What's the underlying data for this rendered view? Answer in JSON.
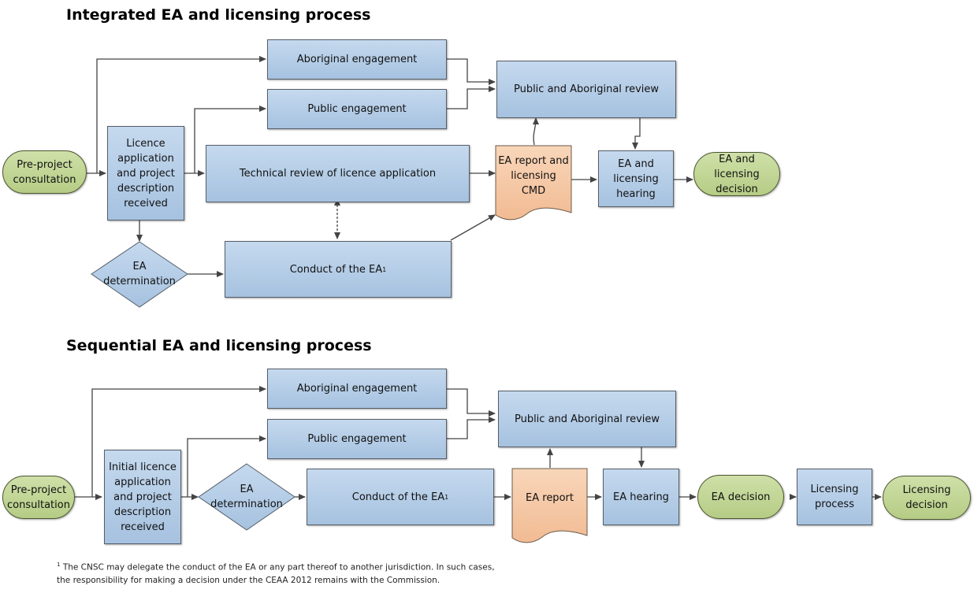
{
  "integrated": {
    "title": "Integrated EA and licensing process",
    "pre_project": "Pre-project\nconsultation",
    "licence_app": "Licence\napplication\nand project\ndescription\nreceived",
    "aboriginal": "Aboriginal engagement",
    "public": "Public engagement",
    "review": "Public and Aboriginal review",
    "technical": "Technical review of licence application",
    "ea_det": "EA\ndetermination",
    "conduct": "Conduct of the EA",
    "conduct_sup": "1",
    "report": "EA report and\nlicensing\nCMD",
    "hearing": "EA and\nlicensing\nhearing",
    "decision": "EA and\nlicensing\ndecision"
  },
  "sequential": {
    "title": "Sequential EA and licensing process",
    "pre_project": "Pre-project\nconsultation",
    "licence_app": "Initial licence\napplication\nand project\ndescription\nreceived",
    "aboriginal": "Aboriginal engagement",
    "public": "Public engagement",
    "review": "Public and Aboriginal review",
    "ea_det": "EA\ndetermination",
    "conduct": "Conduct of the EA",
    "conduct_sup": "1",
    "report": "EA report",
    "hearing": "EA hearing",
    "ea_decision": "EA decision",
    "licensing_process": "Licensing\nprocess",
    "licensing_decision": "Licensing\ndecision"
  },
  "footnote": {
    "marker": "1",
    "line1": "The CNSC may delegate the conduct of the EA or any part thereof to another jurisdiction. In such cases,",
    "line2": "the responsibility for making a decision under the CEAA 2012 remains with the Commission."
  },
  "colors": {
    "process_fill": "#b3cde8",
    "terminal_fill": "#c2d597",
    "document_fill": "#f6c9a6",
    "connector": "#444444"
  }
}
